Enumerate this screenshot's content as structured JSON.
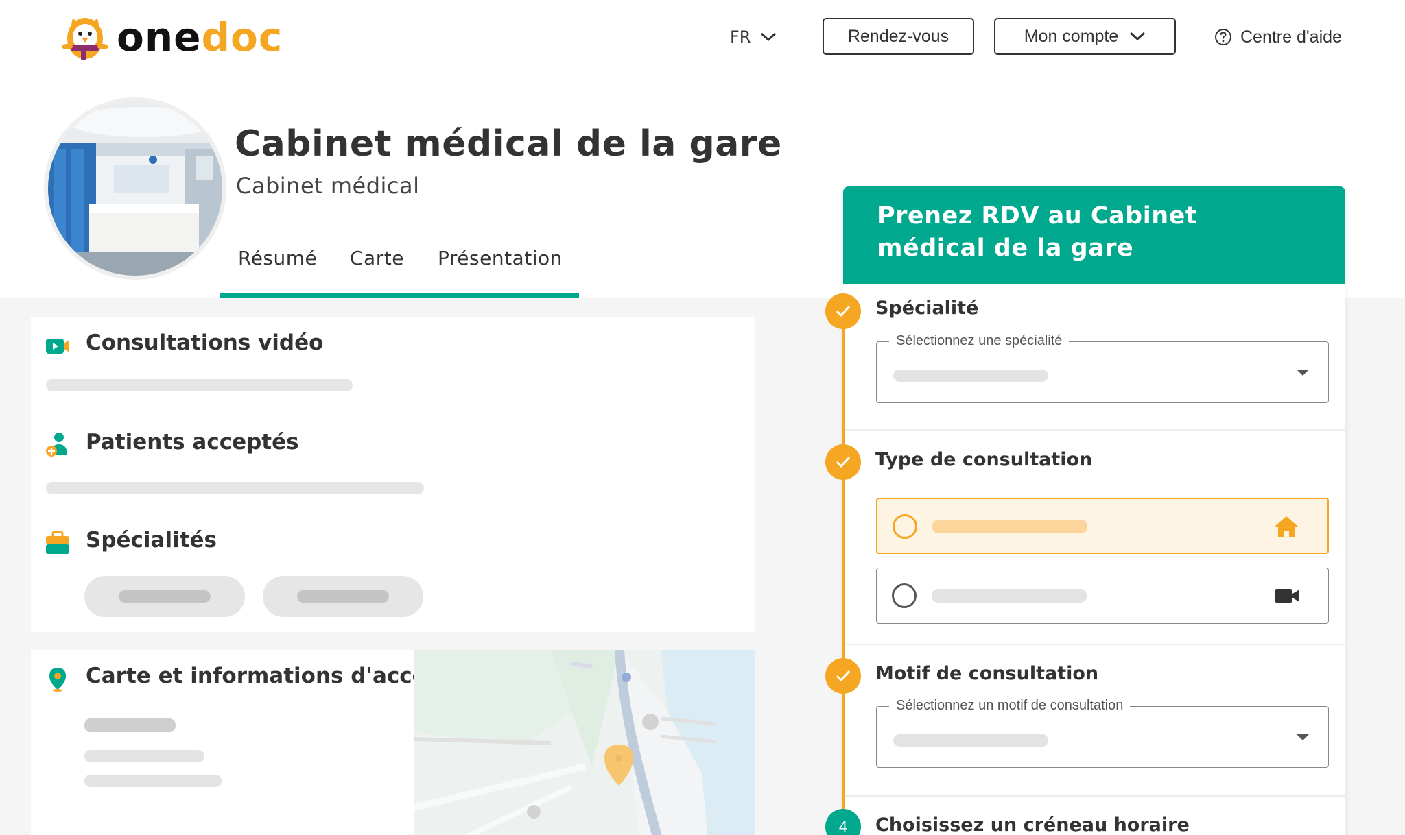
{
  "header": {
    "logo_one": "one",
    "logo_doc": "doc",
    "language": "FR",
    "appointments_button": "Rendez-vous",
    "account_button": "Mon compte",
    "help_link": "Centre d'aide"
  },
  "profile": {
    "name": "Cabinet médical de la gare",
    "type": "Cabinet médical",
    "tabs": [
      "Résumé",
      "Carte",
      "Présentation"
    ],
    "active_tab": "Résumé"
  },
  "info": {
    "video_title": "Consultations vidéo",
    "patients_title": "Patients acceptés",
    "specialties_title": "Spécialités",
    "map_title": "Carte et informations d'accès"
  },
  "booking": {
    "title": "Prenez RDV au Cabinet médical de la gare",
    "steps": [
      {
        "title": "Spécialité",
        "select_label": "Sélectionnez une spécialité",
        "status": "done"
      },
      {
        "title": "Type de consultation",
        "status": "done",
        "options": [
          {
            "icon": "home-icon",
            "selected": true
          },
          {
            "icon": "video-camera-icon",
            "selected": false
          }
        ]
      },
      {
        "title": "Motif de consultation",
        "select_label": "Sélectionnez un motif de consultation",
        "status": "done"
      },
      {
        "number": "4",
        "title": "Choisissez un créneau horaire",
        "status": "pending"
      }
    ]
  },
  "colors": {
    "brand_green": "#00a88e",
    "brand_orange": "#f5a623",
    "text": "#333333",
    "skeleton": "#e6e6e6"
  }
}
